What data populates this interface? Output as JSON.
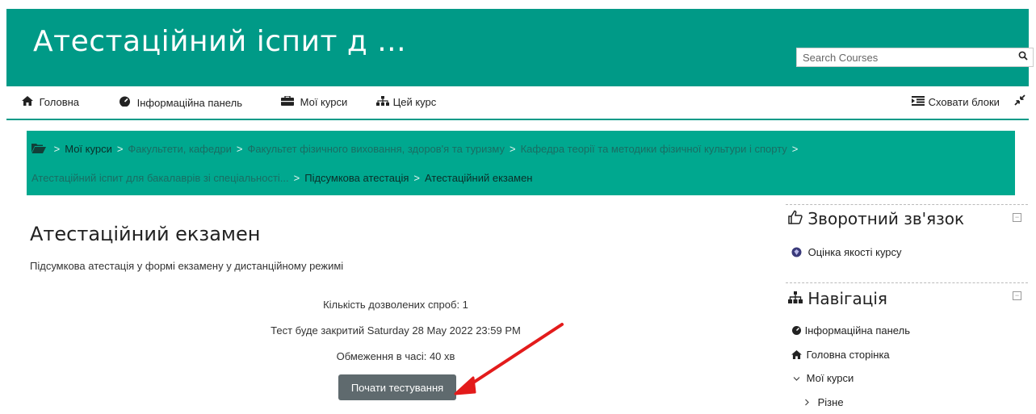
{
  "header": {
    "title": "Атестаційний іспит д ...",
    "search_placeholder": "Search Courses",
    "search_icon": "search-icon"
  },
  "nav": {
    "items": [
      {
        "label": "Головна",
        "icon": "home-icon"
      },
      {
        "label": "Інформаційна панель",
        "icon": "dashboard-icon"
      },
      {
        "label": "Мої курси",
        "icon": "briefcase-icon"
      },
      {
        "label": "Цей курс",
        "icon": "sitemap-icon"
      }
    ],
    "hide_blocks_label": "Сховати блоки"
  },
  "breadcrumb": {
    "items": [
      "Мої курси",
      "Факультети, кафедри",
      "Факультет фізичного виховання, здоров'я та туризму",
      "Кафедра теорії та методики фізичної культури і спорту",
      "Атестаційний іспит для бакалаврів зі спеціальності...",
      "Підсумкова атестація",
      "Атестаційний екзамен"
    ]
  },
  "main": {
    "title": "Атестаційний екзамен",
    "description": "Підсумкова атестація у формі екзамену у дистанційному режимі",
    "attempts": "Кількість дозволених спроб: 1",
    "close_date": "Тест буде закритий Saturday 28 May 2022 23:59 PM",
    "time_limit": "Обмеження в часі: 40 хв",
    "start_button": "Почати тестування"
  },
  "blocks": {
    "feedback": {
      "title": "Зворотний зв'язок",
      "item": "Оцінка якості курсу"
    },
    "navigation": {
      "title": "Навігація",
      "items": [
        "Інформаційна панель",
        "Головна сторінка",
        "Мої курси",
        "Різне"
      ]
    }
  },
  "colors": {
    "header_bg": "#009a87",
    "breadcrumb_bg": "#00a88f",
    "button_bg": "#5f6a6e",
    "arrow": "#e31b1b"
  }
}
